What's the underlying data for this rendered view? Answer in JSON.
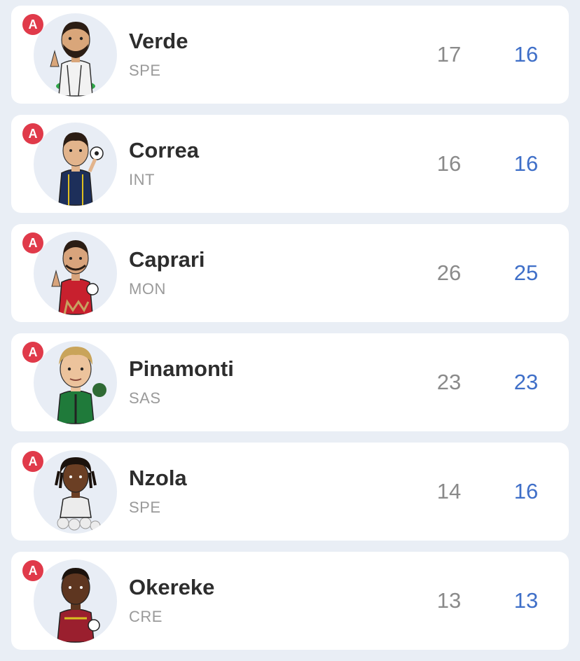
{
  "players": [
    {
      "role": "A",
      "name": "Verde",
      "team": "SPE",
      "value_1": "17",
      "value_2": "16",
      "avatar": "player-cartoon-icon",
      "kit_color": "#f2f2f2",
      "accent": "#2fa84a",
      "skin": "#d9a67a",
      "hair": "#2b1d14"
    },
    {
      "role": "A",
      "name": "Correa",
      "team": "INT",
      "value_1": "16",
      "value_2": "16",
      "avatar": "player-cartoon-icon",
      "kit_color": "#1d2f5a",
      "accent": "#e0c020",
      "skin": "#e2b48c",
      "hair": "#2b1d14"
    },
    {
      "role": "A",
      "name": "Caprari",
      "team": "MON",
      "value_1": "26",
      "value_2": "25",
      "avatar": "player-cartoon-icon",
      "kit_color": "#c8202e",
      "accent": "#c8a060",
      "skin": "#d8a47c",
      "hair": "#2b1d14"
    },
    {
      "role": "A",
      "name": "Pinamonti",
      "team": "SAS",
      "value_1": "23",
      "value_2": "23",
      "avatar": "player-cartoon-icon",
      "kit_color": "#1f7a3a",
      "accent": "#222222",
      "skin": "#ecc39c",
      "hair": "#c9a45a"
    },
    {
      "role": "A",
      "name": "Nzola",
      "team": "SPE",
      "value_1": "14",
      "value_2": "16",
      "avatar": "player-cartoon-icon",
      "kit_color": "#ececec",
      "accent": "#cfcfcf",
      "skin": "#6b3f24",
      "hair": "#1b120c"
    },
    {
      "role": "A",
      "name": "Okereke",
      "team": "CRE",
      "value_1": "13",
      "value_2": "13",
      "avatar": "player-cartoon-icon",
      "kit_color": "#9a1f2e",
      "accent": "#d8c020",
      "skin": "#5e3620",
      "hair": "#1b120c"
    }
  ],
  "colors": {
    "background": "#e9eef5",
    "badge": "#e03a4a",
    "value_highlight": "#3f6fc8"
  }
}
